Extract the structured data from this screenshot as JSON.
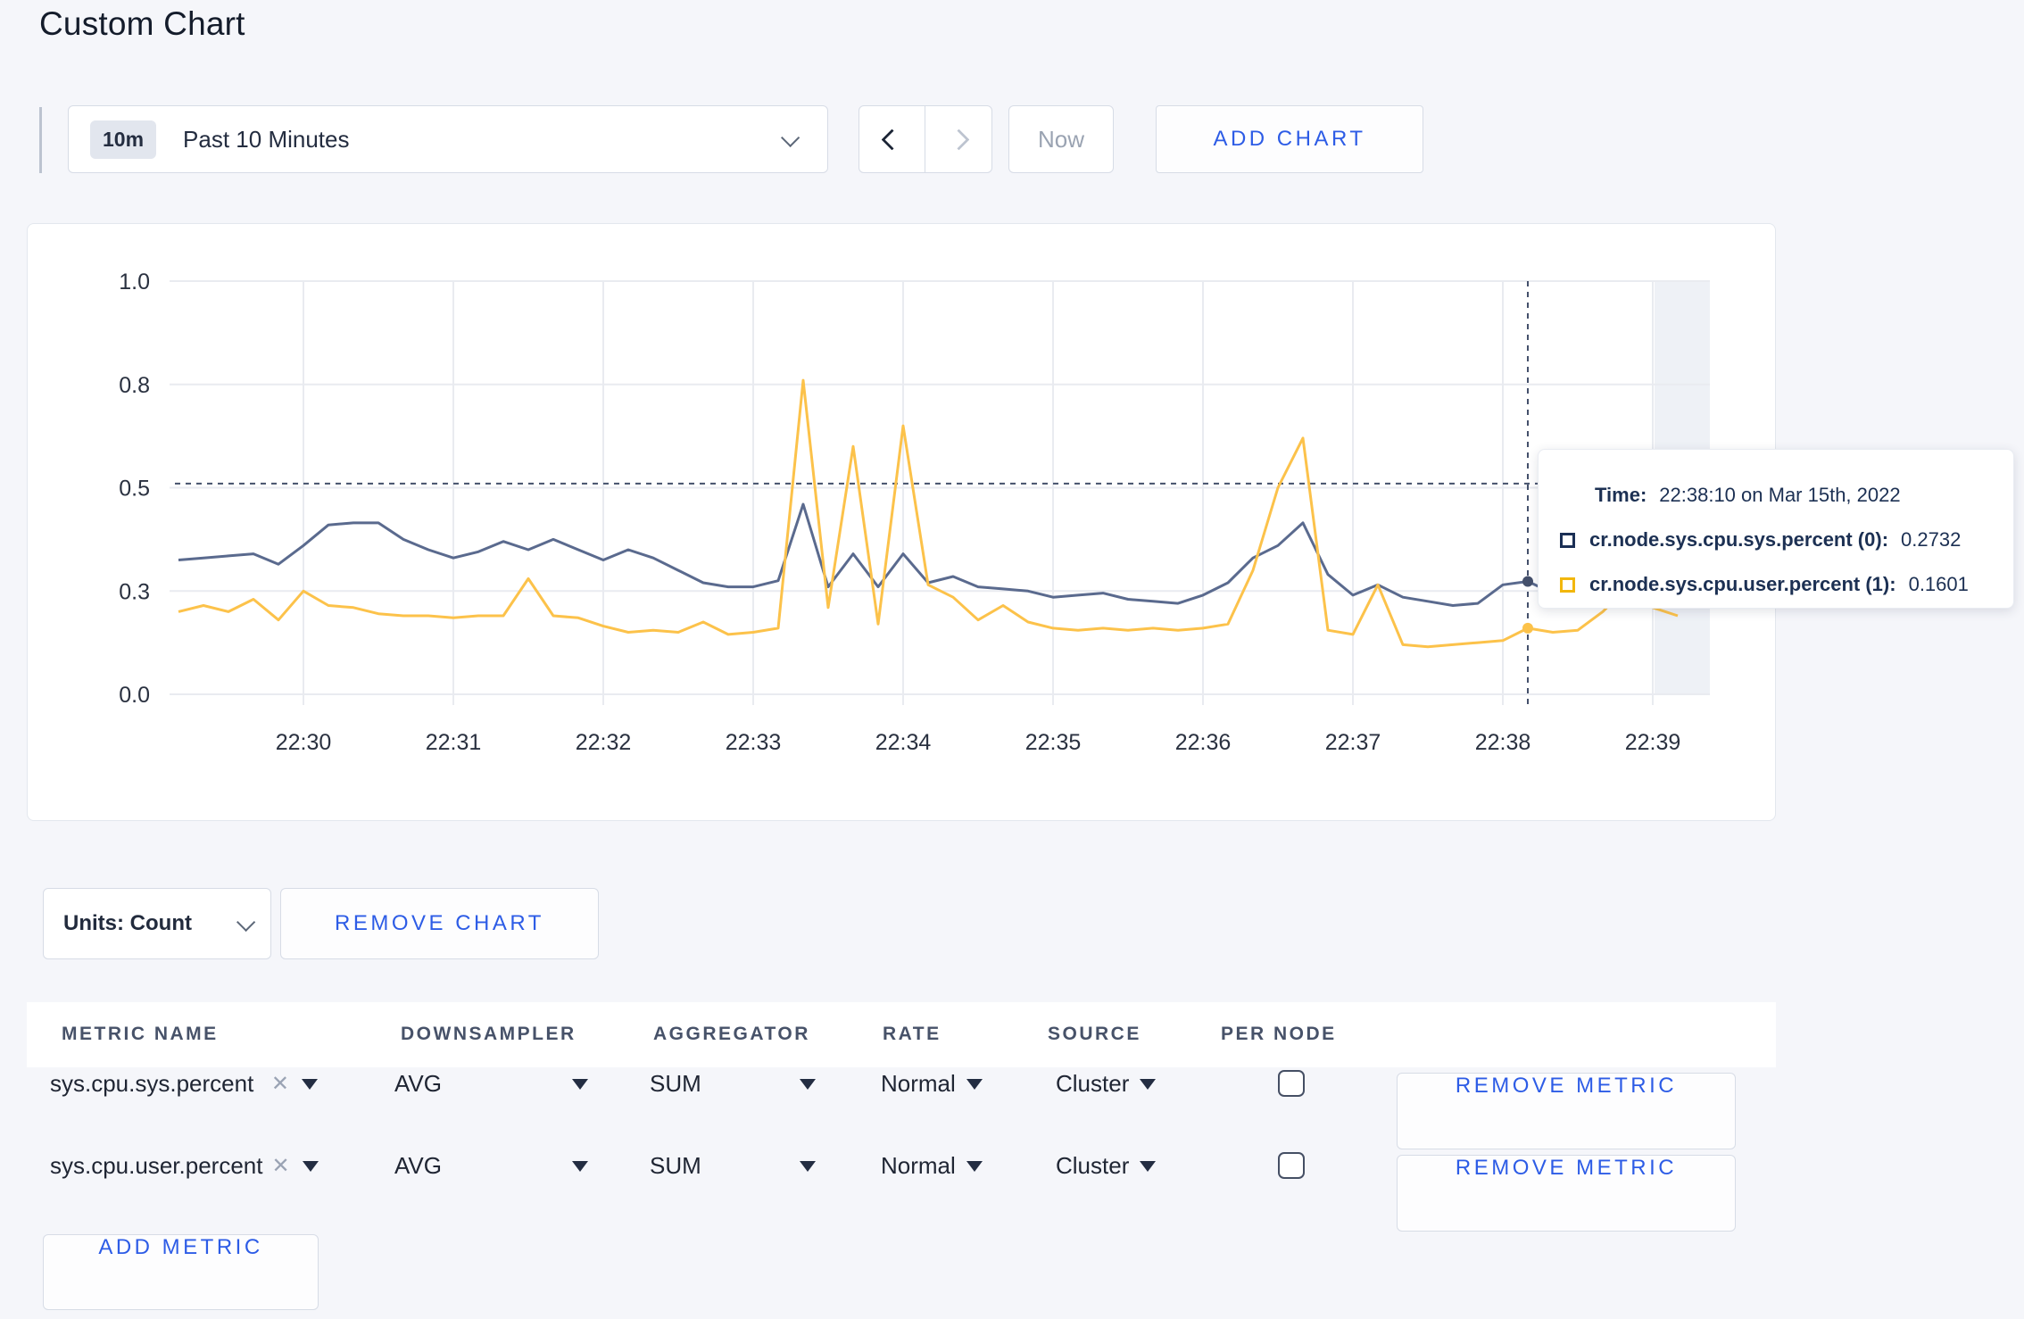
{
  "page": {
    "title": "Custom Chart"
  },
  "toolbar": {
    "time_range_badge": "10m",
    "time_range_label": "Past 10 Minutes",
    "now_label": "Now",
    "add_chart_label": "ADD CHART"
  },
  "tooltip": {
    "time_label": "Time:",
    "time_value": "22:38:10 on Mar 15th, 2022",
    "series": [
      {
        "label": "cr.node.sys.cpu.sys.percent (0):",
        "value": "0.2732",
        "swatch_color": "#1b2f55"
      },
      {
        "label": "cr.node.sys.cpu.user.percent (1):",
        "value": "0.1601",
        "swatch_color": "#f2b70d"
      }
    ]
  },
  "units_row": {
    "units_label": "Units: Count",
    "remove_chart_label": "REMOVE CHART"
  },
  "metrics_table": {
    "headers": [
      "METRIC NAME",
      "DOWNSAMPLER",
      "AGGREGATOR",
      "RATE",
      "SOURCE",
      "PER NODE"
    ],
    "rows": [
      {
        "metric": "sys.cpu.sys.percent",
        "downsampler": "AVG",
        "aggregator": "SUM",
        "rate": "Normal",
        "source": "Cluster",
        "per_node_checked": false,
        "remove_label": "REMOVE METRIC"
      },
      {
        "metric": "sys.cpu.user.percent",
        "downsampler": "AVG",
        "aggregator": "SUM",
        "rate": "Normal",
        "source": "Cluster",
        "per_node_checked": false,
        "remove_label": "REMOVE METRIC"
      }
    ],
    "add_metric_label": "ADD METRIC"
  },
  "colors": {
    "accent_blue": "#2d5ce6",
    "grid": "#e9ebf0",
    "crosshair": "#44506b",
    "future_band": "#eef1f6",
    "axis_text": "#2a3140"
  },
  "chart_data": {
    "type": "line",
    "title": "",
    "xlabel": "",
    "ylabel": "",
    "ylim": [
      0,
      1
    ],
    "grid": true,
    "x_start": "22:29:10",
    "x_end": "22:39:10",
    "x_interval_seconds": 10,
    "x_ticks": [
      "22:30",
      "22:31",
      "22:32",
      "22:33",
      "22:34",
      "22:35",
      "22:36",
      "22:37",
      "22:38",
      "22:39"
    ],
    "y_ticks": [
      {
        "value": 0.0,
        "label": "0.0"
      },
      {
        "value": 0.25,
        "label": "0.3"
      },
      {
        "value": 0.5,
        "label": "0.5"
      },
      {
        "value": 0.75,
        "label": "0.8"
      },
      {
        "value": 1.0,
        "label": "1.0"
      }
    ],
    "series": [
      {
        "name": "cr.node.sys.cpu.sys.percent",
        "color": "#5a6a8e",
        "values": [
          0.325,
          0.33,
          0.335,
          0.34,
          0.315,
          0.36,
          0.41,
          0.415,
          0.415,
          0.375,
          0.35,
          0.33,
          0.345,
          0.37,
          0.35,
          0.375,
          0.35,
          0.325,
          0.35,
          0.33,
          0.3,
          0.27,
          0.26,
          0.26,
          0.275,
          0.46,
          0.26,
          0.34,
          0.26,
          0.34,
          0.27,
          0.285,
          0.26,
          0.255,
          0.25,
          0.235,
          0.24,
          0.245,
          0.23,
          0.225,
          0.22,
          0.24,
          0.27,
          0.33,
          0.36,
          0.415,
          0.29,
          0.24,
          0.265,
          0.235,
          0.225,
          0.215,
          0.22,
          0.265,
          0.2732,
          0.245,
          0.235,
          0.245,
          0.255,
          0.3,
          0.305
        ]
      },
      {
        "name": "cr.node.sys.cpu.user.percent",
        "color": "#fcc24a",
        "values": [
          0.2,
          0.215,
          0.2,
          0.23,
          0.18,
          0.25,
          0.215,
          0.21,
          0.195,
          0.19,
          0.19,
          0.185,
          0.19,
          0.19,
          0.28,
          0.19,
          0.185,
          0.165,
          0.15,
          0.155,
          0.15,
          0.175,
          0.145,
          0.15,
          0.16,
          0.76,
          0.21,
          0.6,
          0.17,
          0.65,
          0.265,
          0.235,
          0.18,
          0.215,
          0.175,
          0.16,
          0.155,
          0.16,
          0.155,
          0.16,
          0.155,
          0.16,
          0.17,
          0.3,
          0.5,
          0.62,
          0.155,
          0.145,
          0.265,
          0.12,
          0.115,
          0.12,
          0.125,
          0.13,
          0.1601,
          0.15,
          0.155,
          0.2,
          0.26,
          0.21,
          0.19
        ]
      }
    ],
    "crosshair": {
      "time": "22:38:10",
      "point_index": 54,
      "hover_y_value": 0.51
    },
    "legend_position": "tooltip",
    "future_band_after_tick": "22:39"
  }
}
